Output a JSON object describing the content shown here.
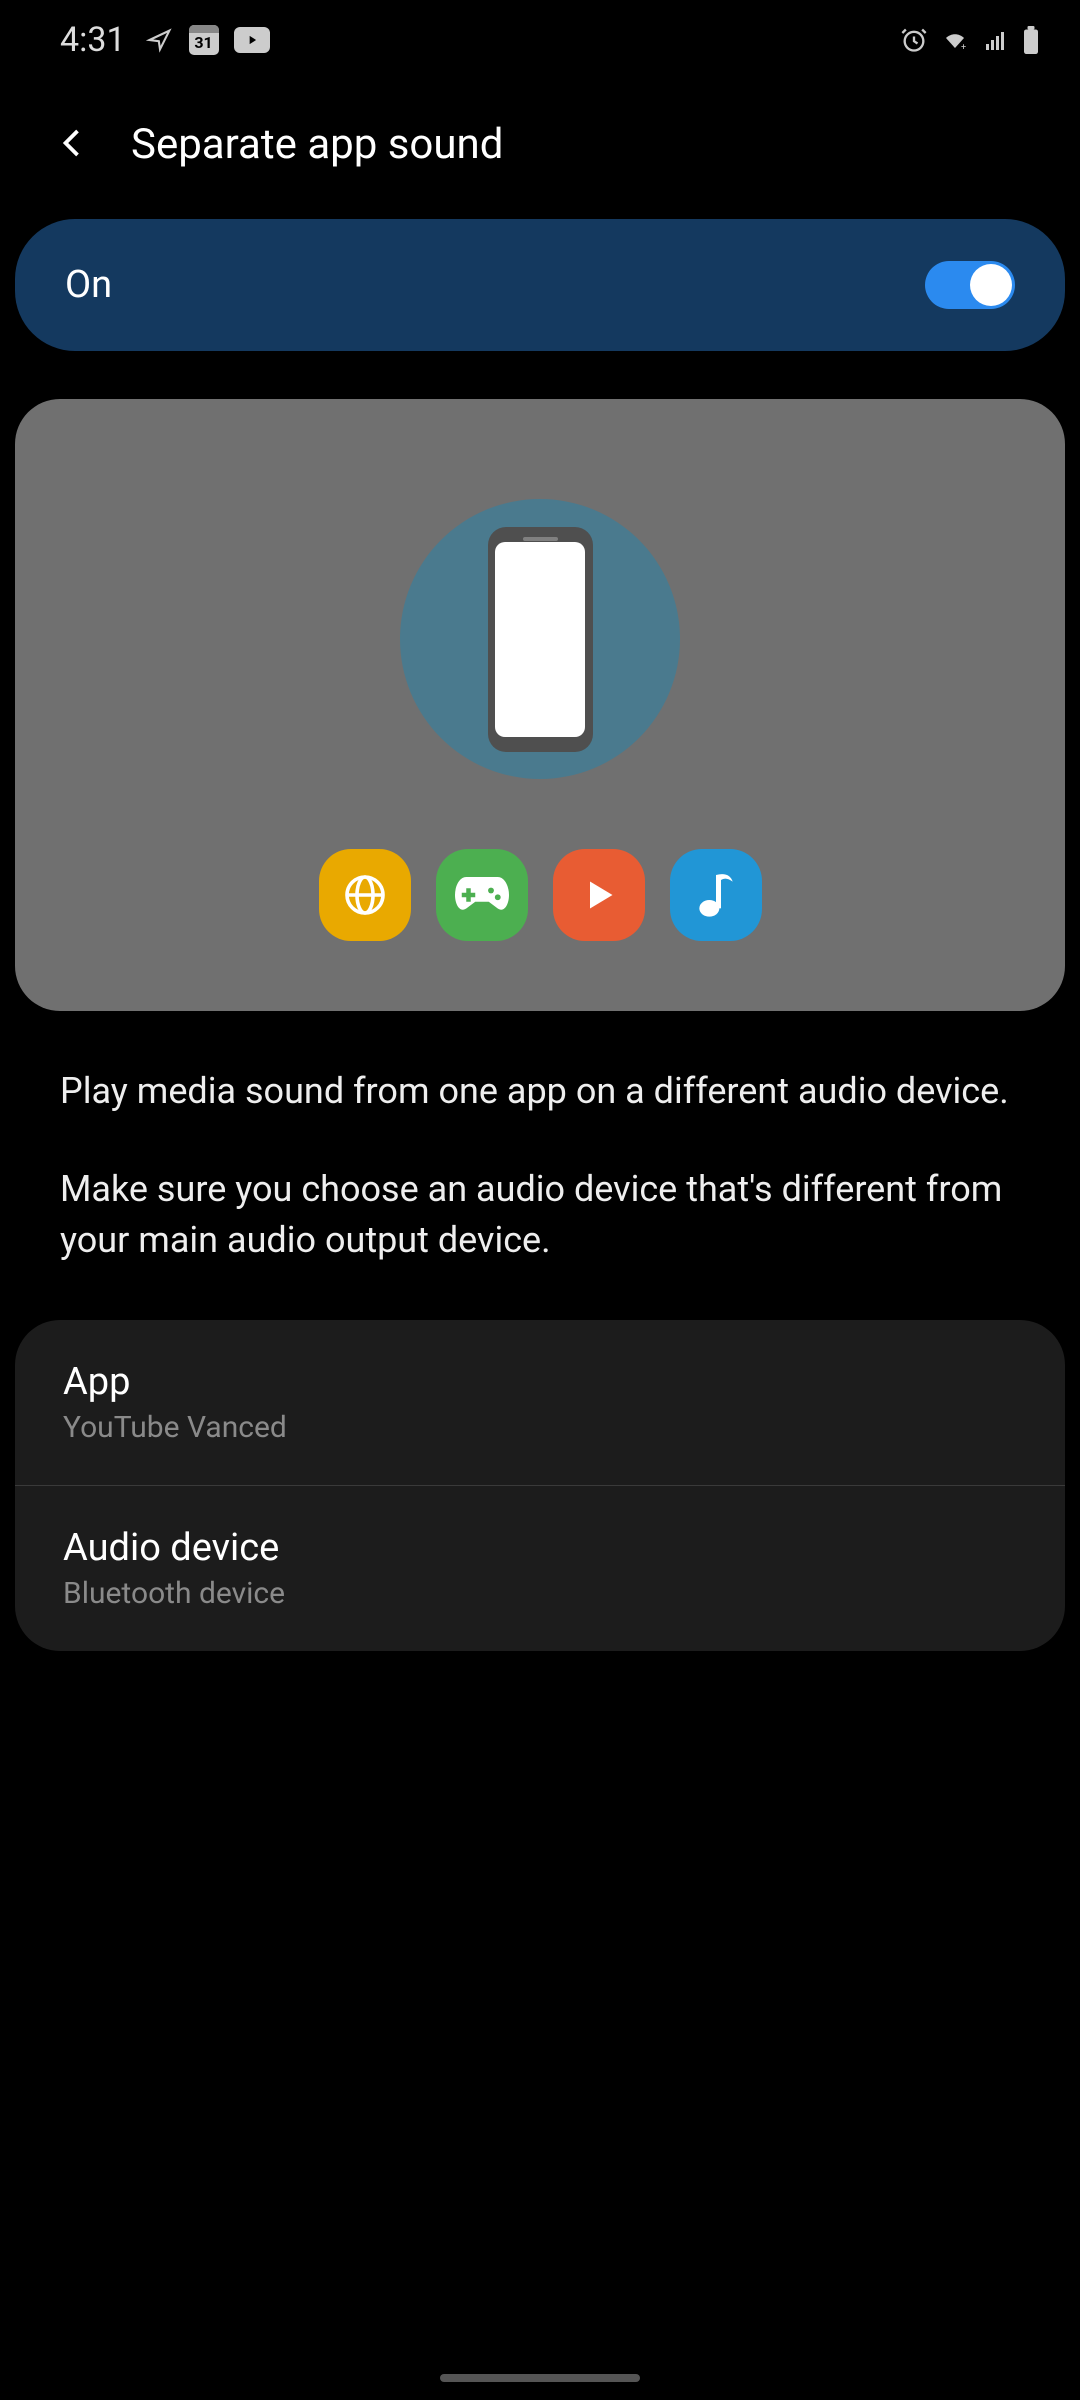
{
  "statusBar": {
    "time": "4:31",
    "calendarDay": "31"
  },
  "header": {
    "title": "Separate app sound"
  },
  "toggle": {
    "label": "On",
    "enabled": true
  },
  "description": {
    "line1": "Play media sound from one app on a different audio device.",
    "line2": "Make sure you choose an audio device that's different from your main audio output device."
  },
  "settings": {
    "app": {
      "title": "App",
      "value": "YouTube Vanced"
    },
    "audioDevice": {
      "title": "Audio device",
      "value": "Bluetooth device"
    }
  }
}
